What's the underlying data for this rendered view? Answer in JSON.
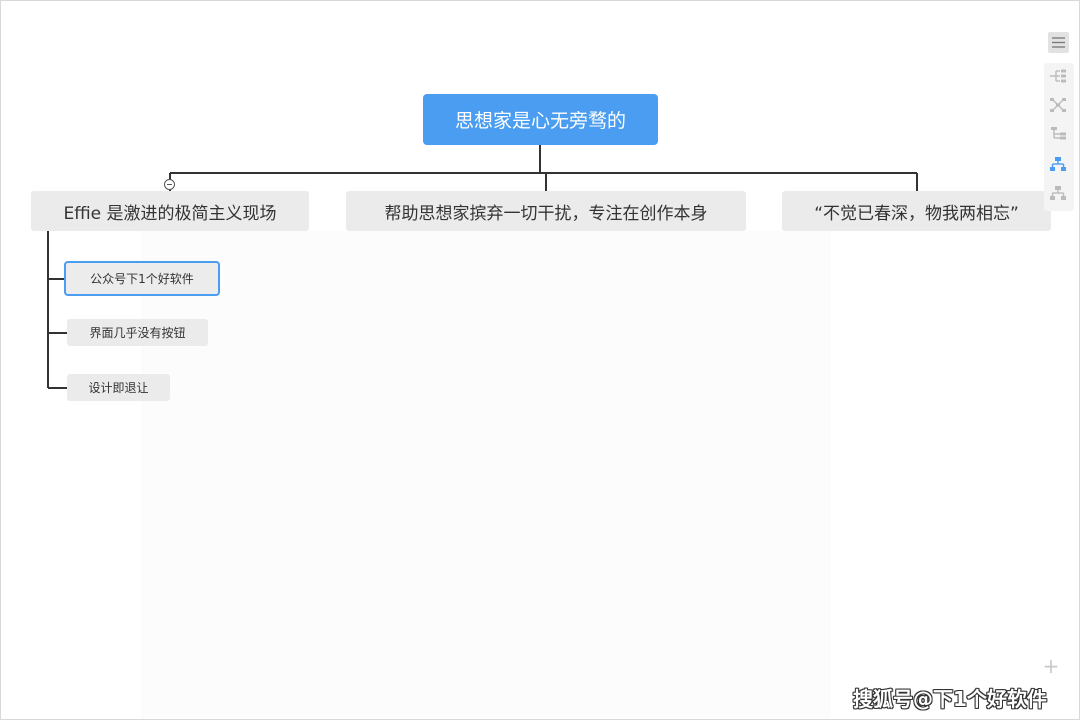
{
  "mindmap": {
    "root": {
      "label": "思想家是心无旁骛的"
    },
    "branches": [
      {
        "label": "Effie 是激进的极简主义现场",
        "children": [
          {
            "label": "公众号下1个好软件"
          },
          {
            "label": "界面几乎没有按钮"
          },
          {
            "label": "设计即退让"
          }
        ]
      },
      {
        "label": "帮助思想家摈弃一切干扰，专注在创作本身"
      },
      {
        "label": "“不觉已春深，物我两相忘”"
      }
    ]
  },
  "toolbar": {
    "icons": [
      "menu-icon",
      "layout-left-icon",
      "layout-both-sides-icon",
      "layout-right-icon",
      "layout-org-chart-icon",
      "layout-tree-icon"
    ],
    "active": "layout-org-chart-icon",
    "active_color": "#4a9df0"
  },
  "zoom": {
    "plus_glyph": "+"
  },
  "watermark": {
    "text": "搜狐号@下1个好软件"
  },
  "colors": {
    "root_fill": "#4a9df0",
    "node_fill": "#ebebeb",
    "selected_border": "#4a9df0",
    "connector": "#333333"
  }
}
